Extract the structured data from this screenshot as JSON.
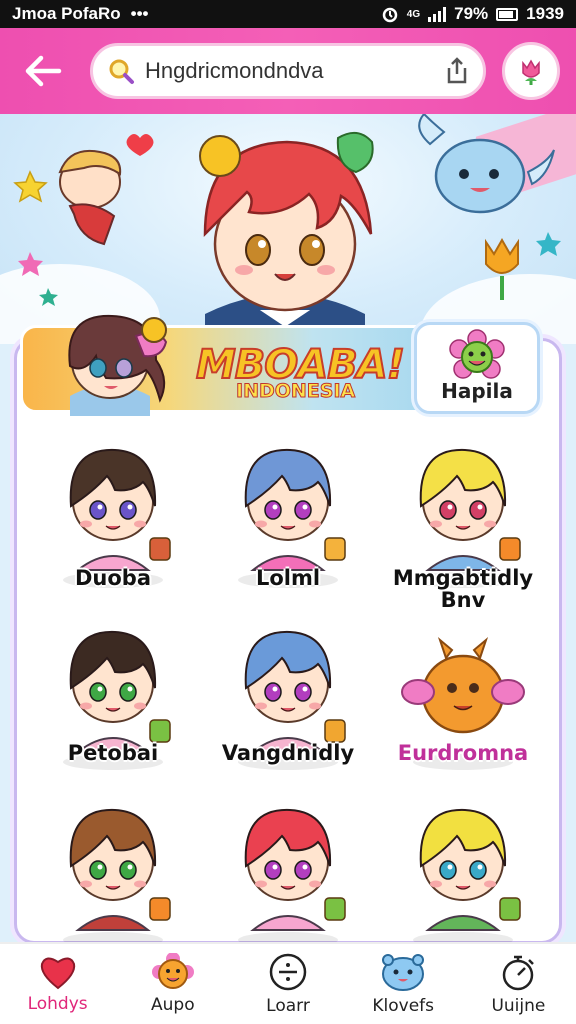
{
  "status_bar": {
    "left_text": "Jmoa PofaRo",
    "more": "•••",
    "signal_text": "4G",
    "battery": "79%",
    "time": "1939"
  },
  "header": {
    "search": {
      "value": "Hngdricmondndva",
      "placeholder": ""
    },
    "icons": {
      "back": "arrow-left-icon",
      "search": "search-icon",
      "share": "share-icon",
      "avatar": "tulip-icon"
    }
  },
  "banner": {
    "title": "MBOABA!",
    "subtitle": "INDONESIA"
  },
  "featured": {
    "label": "Hapila"
  },
  "characters": [
    {
      "label": "Duoba",
      "hair": "#4a3428",
      "shirt": "#f7a6cf",
      "eyes": "#6a55c9",
      "accent": "#d8603a"
    },
    {
      "label": "Lolml",
      "hair": "#6f97d6",
      "shirt": "#f36fb8",
      "eyes": "#b23ebf",
      "accent": "#f4b23c"
    },
    {
      "label": "Mmgabtidly Bnv",
      "hair": "#f4e047",
      "shirt": "#7eb6e8",
      "eyes": "#d24066",
      "accent": "#f48a2a"
    },
    {
      "label": "Petobai",
      "hair": "#3c2a22",
      "shirt": "#f6b4cf",
      "eyes": "#3fa845",
      "accent": "#7ac143"
    },
    {
      "label": "Vangdnidly",
      "hair": "#6a9ad9",
      "shirt": "#f6b4cf",
      "eyes": "#b23ebf",
      "accent": "#f1a630"
    },
    {
      "label": "Eurdromna",
      "hair": "#f39a2f",
      "shirt": "#f39a2f",
      "eyes": "#4a2c1a",
      "accent": "#f07cc4"
    },
    {
      "label": "",
      "hair": "#9a5a2e",
      "shirt": "#c0403a",
      "eyes": "#3fa845",
      "accent": "#f48a2a"
    },
    {
      "label": "",
      "hair": "#ea4150",
      "shirt": "#f6a6cf",
      "eyes": "#b23ebf",
      "accent": "#7ac143"
    },
    {
      "label": "",
      "hair": "#f2e040",
      "shirt": "#63b55a",
      "eyes": "#3aa9c8",
      "accent": "#7ac143"
    }
  ],
  "nav": [
    {
      "label": "Lohdys",
      "icon": "heart-icon",
      "active": true
    },
    {
      "label": "Aupo",
      "icon": "smiley-flower-icon",
      "active": false
    },
    {
      "label": "Loarr",
      "icon": "divide-icon",
      "active": false
    },
    {
      "label": "Klovefs",
      "icon": "blue-blob-icon",
      "active": false
    },
    {
      "label": "Uuijne",
      "icon": "stopwatch-icon",
      "active": false
    }
  ],
  "colors": {
    "header_pink": "#f052b2",
    "card_border": "#c9b8ef",
    "accent_label": "#e0277a"
  }
}
